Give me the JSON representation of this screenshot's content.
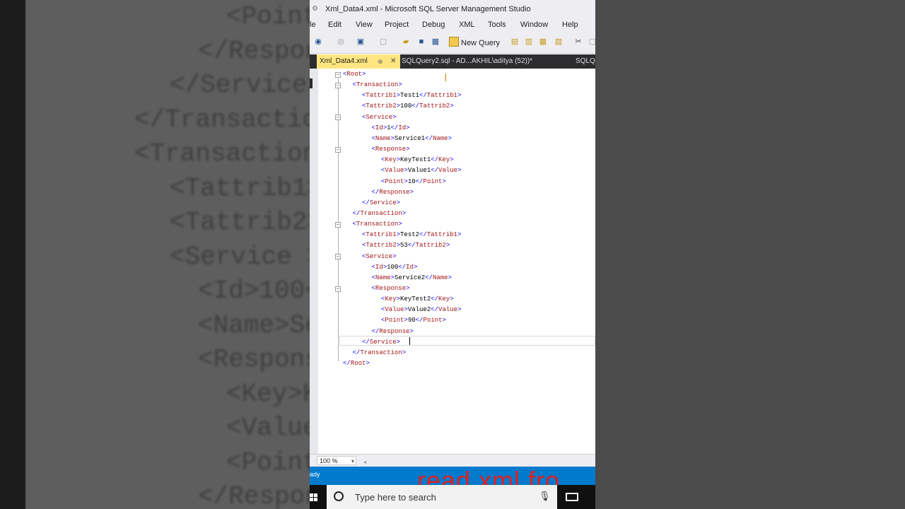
{
  "window": {
    "title": "Xml_Data4.xml - Microsoft SQL Server Management Studio"
  },
  "menu": [
    "le",
    "Edit",
    "View",
    "Project",
    "Debug",
    "XML",
    "Tools",
    "Window",
    "Help"
  ],
  "toolbar": {
    "new_query_label": "New Query"
  },
  "tabs": [
    {
      "label": "Xml_Data4.xml",
      "active": true
    },
    {
      "label": "SQLQuery2.sql - AD...AKHIL\\aditya (52))*",
      "active": false
    },
    {
      "label": "SQLQ",
      "active": false
    }
  ],
  "editor": {
    "lines": [
      {
        "indent": 0,
        "open": "Root",
        "text": "",
        "close": ""
      },
      {
        "indent": 1,
        "open": "Transaction",
        "text": "",
        "close": ""
      },
      {
        "indent": 2,
        "open": "Tattrib1",
        "text": "Test1",
        "close": "Tattrib1"
      },
      {
        "indent": 2,
        "open": "Tattrib2",
        "text": "100",
        "close": "Tattrib2"
      },
      {
        "indent": 2,
        "open": "Service",
        "text": "",
        "close": ""
      },
      {
        "indent": 3,
        "open": "Id",
        "text": "1",
        "close": "Id"
      },
      {
        "indent": 3,
        "open": "Name",
        "text": "Service1",
        "close": "Name"
      },
      {
        "indent": 3,
        "open": "Response",
        "text": "",
        "close": ""
      },
      {
        "indent": 4,
        "open": "Key",
        "text": "KeyTest1",
        "close": "Key"
      },
      {
        "indent": 4,
        "open": "Value",
        "text": "Value1",
        "close": "Value"
      },
      {
        "indent": 4,
        "open": "Point",
        "text": "10",
        "close": "Point"
      },
      {
        "indent": 3,
        "open": "",
        "text": "",
        "close": "Response"
      },
      {
        "indent": 2,
        "open": "",
        "text": "",
        "close": "Service"
      },
      {
        "indent": 1,
        "open": "",
        "text": "",
        "close": "Transaction"
      },
      {
        "indent": 1,
        "open": "Transaction",
        "text": "",
        "close": ""
      },
      {
        "indent": 2,
        "open": "Tattrib1",
        "text": "Test2",
        "close": "Tattrib1"
      },
      {
        "indent": 2,
        "open": "Tattrib2",
        "text": "53",
        "close": "Tattrib2"
      },
      {
        "indent": 2,
        "open": "Service",
        "text": "",
        "close": ""
      },
      {
        "indent": 3,
        "open": "Id",
        "text": "100",
        "close": "Id"
      },
      {
        "indent": 3,
        "open": "Name",
        "text": "Service2",
        "close": "Name"
      },
      {
        "indent": 3,
        "open": "Response",
        "text": "",
        "close": ""
      },
      {
        "indent": 4,
        "open": "Key",
        "text": "KeyTest2",
        "close": "Key"
      },
      {
        "indent": 4,
        "open": "Value",
        "text": "Value2",
        "close": "Value"
      },
      {
        "indent": 4,
        "open": "Point",
        "text": "90",
        "close": "Point"
      },
      {
        "indent": 3,
        "open": "",
        "text": "",
        "close": "Response"
      },
      {
        "indent": 2,
        "open": "",
        "text": "",
        "close": "Service"
      },
      {
        "indent": 1,
        "open": "",
        "text": "",
        "close": "Transaction"
      },
      {
        "indent": 0,
        "open": "",
        "text": "",
        "close": "Root"
      }
    ],
    "fold_lines": [
      0,
      1,
      4,
      7,
      14,
      17,
      20
    ]
  },
  "zoom": {
    "value": "100 %"
  },
  "statusbar": {
    "text": "ady"
  },
  "overlay": {
    "text": "read xml fro",
    "color": "#e02020"
  },
  "taskbar": {
    "search_placeholder": "Type here to search"
  },
  "background_blur": {
    "lines": [
      "<Point",
      "</Respons",
      "</Service>",
      "</Transactio",
      "<Transaction",
      "<Tattrib1>",
      "<Tattrib2>",
      "<Service >",
      "<Id>100<",
      "<Name>Se",
      "<Respons",
      "<Key>K",
      "<Value",
      "<Point",
      "</Respons"
    ]
  },
  "colors": {
    "statusbar": "#007acc",
    "tab_active": "#ffe680",
    "tag": "#a31515",
    "bracket": "#0000ff"
  }
}
